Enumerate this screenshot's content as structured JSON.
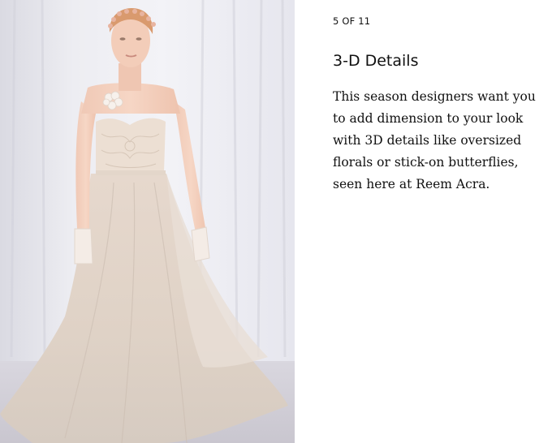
{
  "slide": {
    "counter": "5 OF 11",
    "title": "3-D Details",
    "caption": "This season designers want you to add dimension to your look with 3D details like oversized florals or stick-on butterflies, seen here at Reem Acra."
  },
  "photo": {
    "subject": "runway-gown-photo"
  }
}
